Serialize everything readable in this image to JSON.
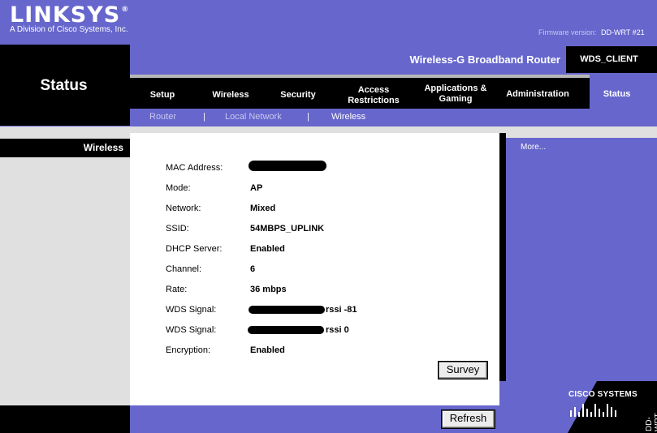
{
  "header": {
    "logo_text": "LINKSYS",
    "logo_reg": "®",
    "tagline": "A Division of Cisco Systems, Inc.",
    "firmware_label": "Firmware version:",
    "firmware_value": "DD-WRT #21"
  },
  "section": {
    "title": "Status"
  },
  "product": {
    "name": "Wireless-G Broadband Router",
    "device_name": "WDS_CLIENT"
  },
  "tabs": [
    {
      "label": "Setup"
    },
    {
      "label": "Wireless"
    },
    {
      "label": "Security"
    },
    {
      "label": "Access Restrictions"
    },
    {
      "label": "Applications & Gaming"
    },
    {
      "label": "Administration"
    },
    {
      "label": "Status",
      "active": true
    }
  ],
  "subnav": {
    "items": [
      {
        "label": "Router"
      },
      {
        "label": "Local Network"
      },
      {
        "label": "Wireless",
        "active": true
      }
    ],
    "separator": "|"
  },
  "sidebar": {
    "section_label": "Wireless"
  },
  "wireless_info": {
    "rows": [
      {
        "label": "MAC Address:",
        "value": ""
      },
      {
        "label": "Mode:",
        "value": "AP"
      },
      {
        "label": "Network:",
        "value": "Mixed"
      },
      {
        "label": "SSID:",
        "value": "54MBPS_UPLINK"
      },
      {
        "label": "DHCP Server:",
        "value": "Enabled"
      },
      {
        "label": "Channel:",
        "value": "6"
      },
      {
        "label": "Rate:",
        "value": "36 mbps"
      },
      {
        "label": "WDS Signal:",
        "value": "rssi -81"
      },
      {
        "label": "WDS Signal:",
        "value": "rssi 0"
      },
      {
        "label": "Encryption:",
        "value": "Enabled"
      }
    ]
  },
  "buttons": {
    "survey": "Survey",
    "refresh": "Refresh"
  },
  "help": {
    "more_label": "More..."
  },
  "footer": {
    "cisco_logo_text": "CISCO SYSTEMS",
    "ddwrt_label": "DD-WRT"
  },
  "colors": {
    "brand_purple": "#6666cc",
    "black": "#000000",
    "panel_grey": "#e0e0e0",
    "subnav_inactive": "#c8c8ee"
  }
}
